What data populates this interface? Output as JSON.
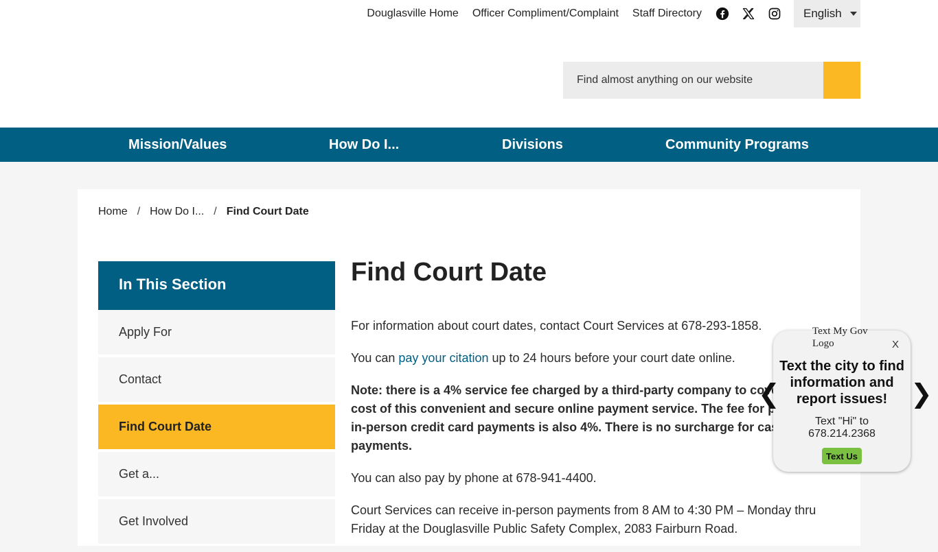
{
  "utility_nav": {
    "links": [
      "Douglasville Home",
      "Officer Compliment/Complaint",
      "Staff Directory"
    ],
    "social_icons": [
      "facebook-icon",
      "x-twitter-icon",
      "instagram-icon"
    ],
    "language": "English"
  },
  "search": {
    "placeholder": "Find almost anything on our website"
  },
  "main_nav": [
    "Mission/Values",
    "How Do I...",
    "Divisions",
    "Community Programs"
  ],
  "breadcrumb": {
    "items": [
      "Home",
      "How Do I...",
      "Find Court Date"
    ],
    "separator": "/"
  },
  "sidebar": {
    "title": "In This Section",
    "items": [
      "Apply For",
      "Contact",
      "Find Court Date",
      "Get a...",
      "Get Involved"
    ],
    "active_index": 2
  },
  "content": {
    "title": "Find Court Date",
    "p1": "For information about court dates, contact Court Services at 678-293-1858.",
    "p2_before": "You can ",
    "p2_link": "pay your citation",
    "p2_after": " up to 24 hours before your court date online.",
    "note": "Note: there is a 4% service fee charged by a third-party company to cover the cost of this convenient and secure online payment service. The fee for phone and in-person credit card payments is also 4%. There is no surcharge for cash payments.",
    "p4": "You can also pay by phone at 678-941-4400.",
    "p5": "Court Services can receive in-person payments from 8 AM to 4:30 PM – Monday thru Friday at the Douglasville Public Safety Complex, 2083 Fairburn Road."
  },
  "widget": {
    "logo_alt": "Text My Gov Logo",
    "close": "X",
    "headline": "Text the city to find information and report issues!",
    "sub_line1": "Text \"Hi\" to",
    "sub_line2": "678.214.2368",
    "button": "Text Us",
    "prev": "❮",
    "next": "❯"
  },
  "colors": {
    "brand_blue": "#005f83",
    "accent_yellow": "#fbb823",
    "widget_green": "#7ac142"
  }
}
